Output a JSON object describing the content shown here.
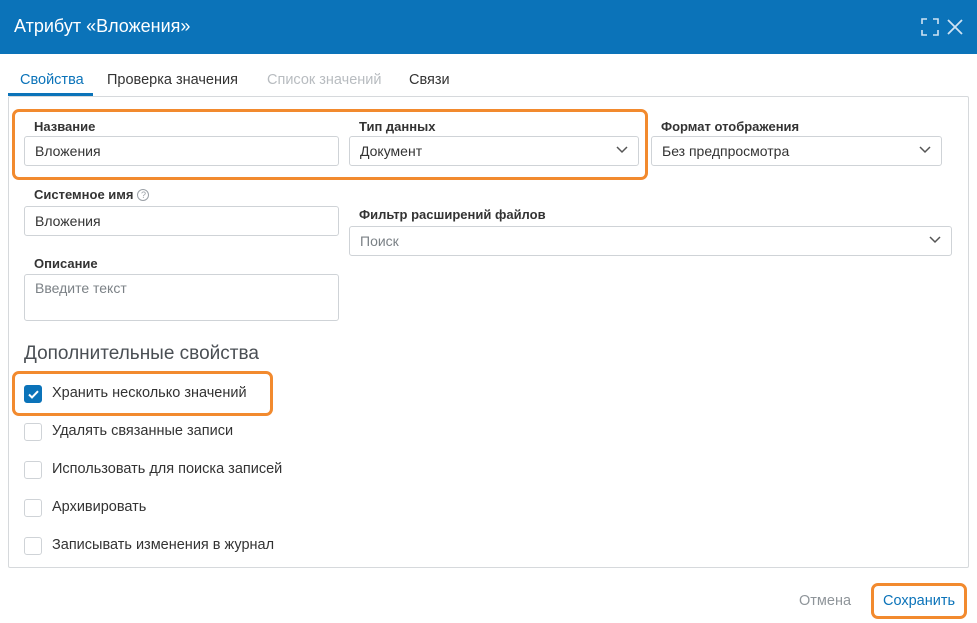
{
  "dialog": {
    "title": "Атрибут «Вложения»"
  },
  "tabs": [
    {
      "label": "Свойства",
      "state": "active"
    },
    {
      "label": "Проверка значения",
      "state": "normal"
    },
    {
      "label": "Список значений",
      "state": "disabled"
    },
    {
      "label": "Связи",
      "state": "normal"
    }
  ],
  "form": {
    "name": {
      "label": "Название",
      "value": "Вложения"
    },
    "data_type": {
      "label": "Тип данных",
      "value": "Документ"
    },
    "display_format": {
      "label": "Формат отображения",
      "value": "Без предпросмотра"
    },
    "system_name": {
      "label": "Системное имя",
      "help": "?",
      "value": "Вложения"
    },
    "file_filter": {
      "label": "Фильтр расширений файлов",
      "placeholder": "Поиск"
    },
    "description": {
      "label": "Описание",
      "placeholder": "Введите текст"
    }
  },
  "extra": {
    "title": "Дополнительные свойства",
    "options": [
      {
        "label": "Хранить несколько значений",
        "checked": true
      },
      {
        "label": "Удалять связанные записи",
        "checked": false
      },
      {
        "label": "Использовать для поиска записей",
        "checked": false
      },
      {
        "label": "Архивировать",
        "checked": false
      },
      {
        "label": "Записывать изменения в журнал",
        "checked": false
      }
    ]
  },
  "footer": {
    "cancel_label": "Отмена",
    "save_label": "Сохранить"
  },
  "colors": {
    "accent": "#0b73b9",
    "highlight": "#f28a2e"
  },
  "icons": {
    "expand": "expand-icon",
    "close": "close-icon",
    "dropdown": "chevron-down-icon",
    "check": "check-icon"
  }
}
